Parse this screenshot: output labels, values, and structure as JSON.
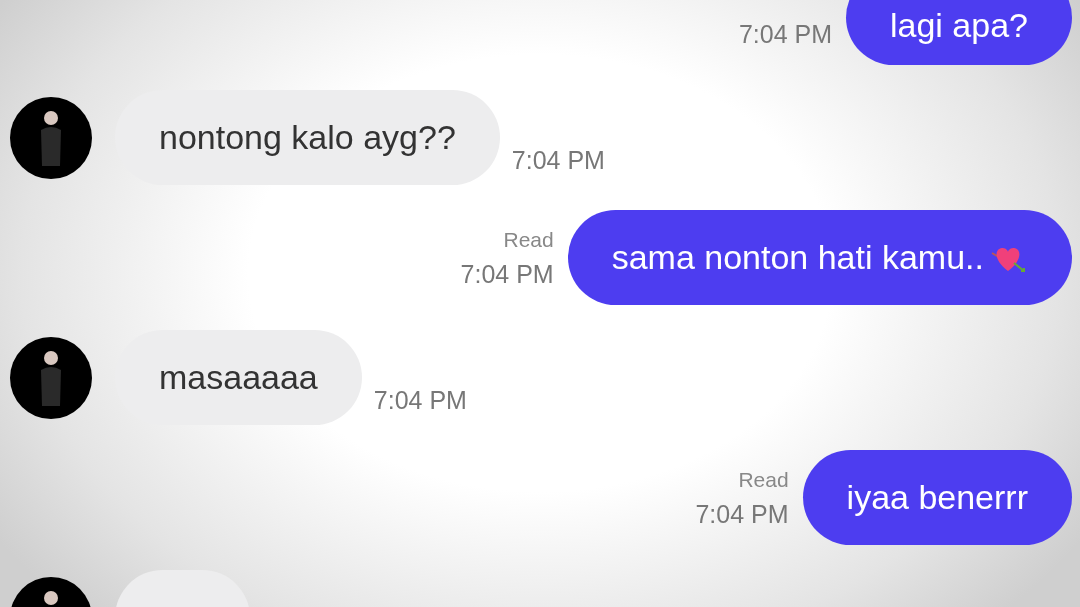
{
  "messages": [
    {
      "kind": "sent",
      "text": "lagi apa?",
      "time": "7:04 PM"
    },
    {
      "kind": "received",
      "text": "nontong kalo ayg??",
      "time": "7:04 PM"
    },
    {
      "kind": "sent",
      "status": "Read",
      "text": "sama nonton hati kamu..",
      "time": "7:04 PM",
      "heart_icon": true
    },
    {
      "kind": "received",
      "text": "masaaaaa",
      "time": "7:04 PM"
    },
    {
      "kind": "sent",
      "status": "Read",
      "text": "iyaa benerrr",
      "time": "7:04 PM"
    },
    {
      "kind": "received"
    }
  ]
}
